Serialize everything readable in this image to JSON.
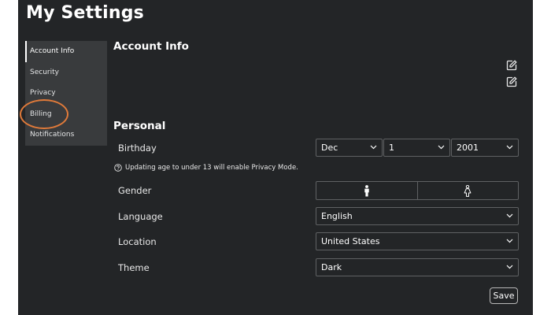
{
  "header": {
    "title": "My Settings"
  },
  "sidebar": {
    "items": [
      {
        "label": "Account Info",
        "active": true
      },
      {
        "label": "Security"
      },
      {
        "label": "Privacy"
      },
      {
        "label": "Billing"
      },
      {
        "label": "Notifications"
      }
    ]
  },
  "account": {
    "title": "Account Info"
  },
  "personal": {
    "title": "Personal",
    "birthday": {
      "label": "Birthday",
      "month": "Dec",
      "day": "1",
      "year": "2001"
    },
    "note": "Updating age to under 13 will enable Privacy Mode.",
    "gender": {
      "label": "Gender",
      "options": [
        "male-icon",
        "female-icon"
      ]
    },
    "language": {
      "label": "Language",
      "value": "English"
    },
    "location": {
      "label": "Location",
      "value": "United States"
    },
    "theme": {
      "label": "Theme",
      "value": "Dark"
    }
  },
  "actions": {
    "save_label": "Save"
  },
  "colors": {
    "background": "#232527",
    "sidebar": "#393b3d",
    "annotation": "#e07a3a"
  }
}
